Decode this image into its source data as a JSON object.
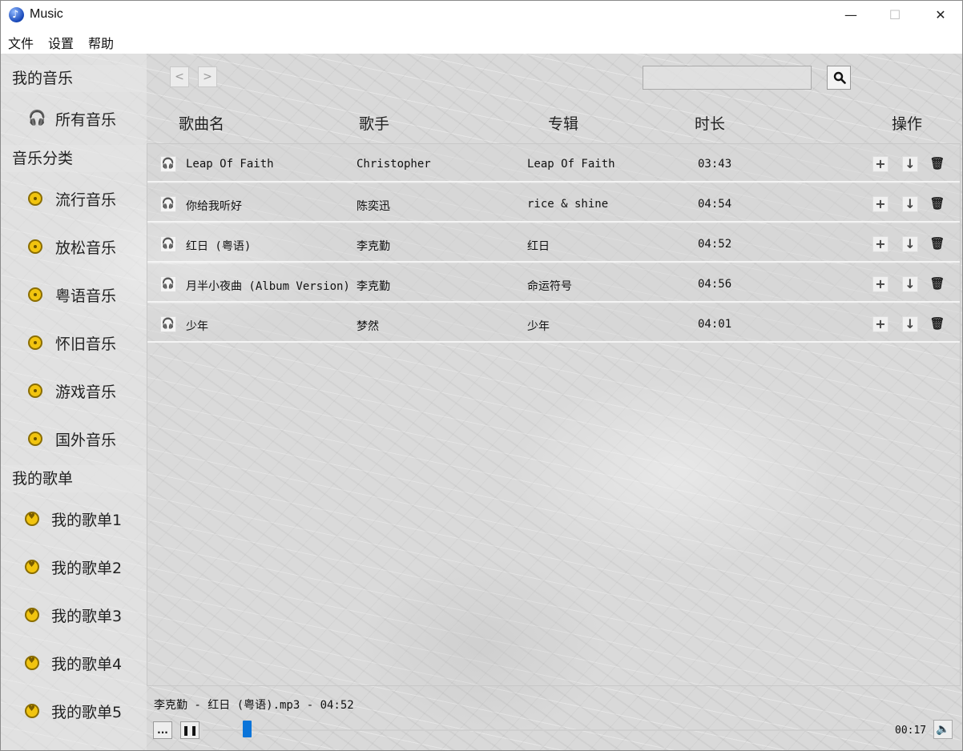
{
  "app": {
    "title": "Music"
  },
  "window_controls": {
    "minimize": "—",
    "maximize": "☐",
    "close": "✕"
  },
  "menu": [
    "文件",
    "设置",
    "帮助"
  ],
  "sidebar": {
    "my_music_header": "我的音乐",
    "all_music": "所有音乐",
    "category_header": "音乐分类",
    "categories": [
      "流行音乐",
      "放松音乐",
      "粤语音乐",
      "怀旧音乐",
      "游戏音乐",
      "国外音乐"
    ],
    "playlist_header": "我的歌单",
    "playlists": [
      "我的歌单1",
      "我的歌单2",
      "我的歌单3",
      "我的歌单4",
      "我的歌单5"
    ]
  },
  "toolbar": {
    "back": "<",
    "forward": ">",
    "search_placeholder": "",
    "search_icon": "search-icon"
  },
  "columns": {
    "song": "歌曲名",
    "artist": "歌手",
    "album": "专辑",
    "duration": "时长",
    "actions": "操作"
  },
  "songs": [
    {
      "title": "Leap Of Faith",
      "artist": "Christopher",
      "album": "Leap Of Faith",
      "duration": "03:43"
    },
    {
      "title": "你给我听好",
      "artist": "陈奕迅",
      "album": "rice & shine",
      "duration": "04:54"
    },
    {
      "title": "红日 (粤语)",
      "artist": "李克勤",
      "album": "红日",
      "duration": "04:52"
    },
    {
      "title": "月半小夜曲 (Album Version)",
      "artist": "李克勤",
      "album": "命运符号",
      "duration": "04:56"
    },
    {
      "title": "少年",
      "artist": "梦然",
      "album": "少年",
      "duration": "04:01"
    }
  ],
  "player": {
    "now_playing": "李克勤 - 红日 (粤语).mp3 - 04:52",
    "menu_button": "...",
    "pause_button": "❚❚",
    "elapsed": "00:17",
    "progress_fraction": 0.065
  },
  "colors": {
    "progress_handle": "#0a74d9",
    "category_icon": "#f1c40f"
  }
}
